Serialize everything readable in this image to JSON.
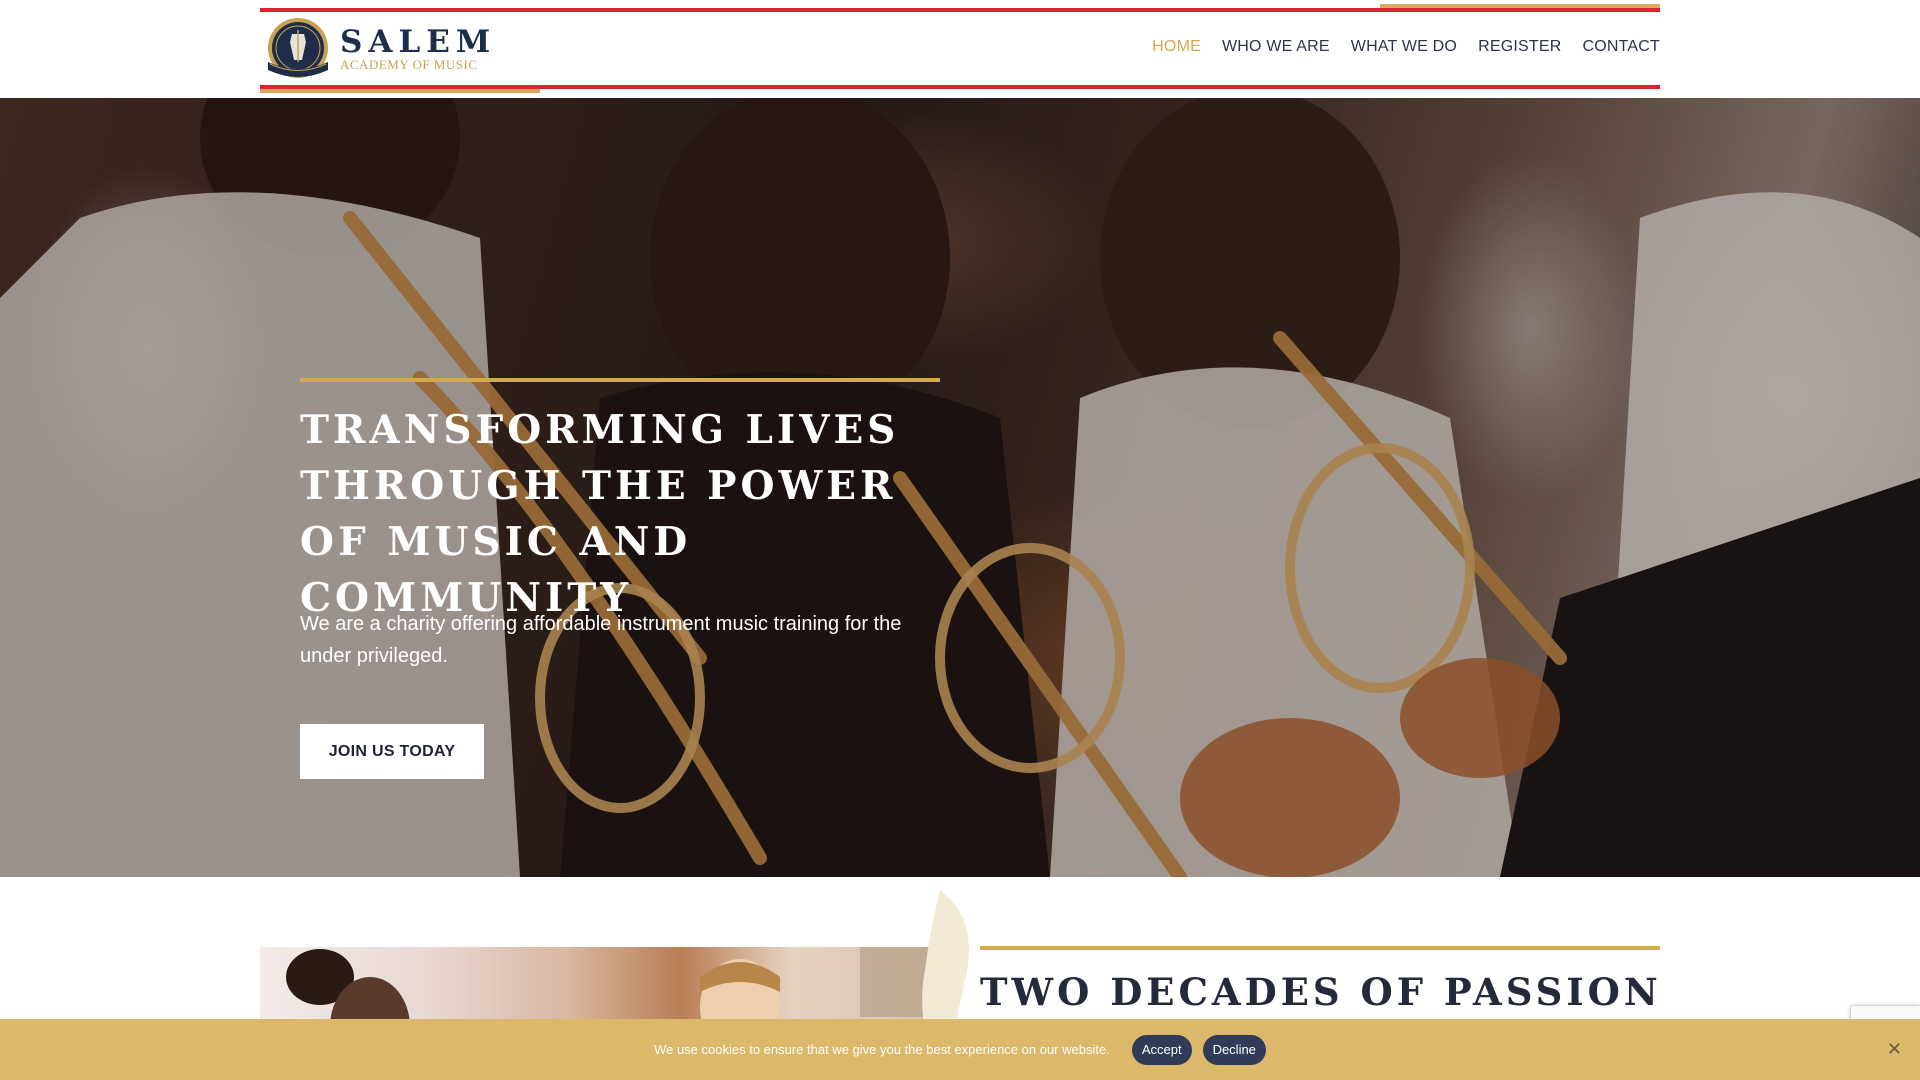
{
  "header": {
    "logo": {
      "name": "SALEM",
      "subtitle": "ACADEMY OF MUSIC",
      "crest_text": "SALEM ACADEMY OF MUSIC"
    },
    "nav": [
      {
        "label": "HOME",
        "active": true
      },
      {
        "label": "WHO WE ARE",
        "active": false
      },
      {
        "label": "WHAT WE DO",
        "active": false
      },
      {
        "label": "REGISTER",
        "active": false
      },
      {
        "label": "CONTACT",
        "active": false
      }
    ]
  },
  "hero": {
    "title": "TRANSFORMING LIVES THROUGH THE POWER OF MUSIC AND COMMUNITY",
    "text": "We are a charity offering affordable instrument music training for the under privileged.",
    "button_label": "JOIN US TODAY"
  },
  "section2": {
    "title": "TWO DECADES OF PASSION"
  },
  "cookie": {
    "text": "We use cookies to ensure that we give you the best experience on our website.",
    "accept_label": "Accept",
    "decline_label": "Decline",
    "close_icon": "close-icon"
  },
  "colors": {
    "accent_gold": "#d4aa4f",
    "accent_red": "#d7262d",
    "navy": "#1f2c4a",
    "cookie_bar": "#dcb86a",
    "cookie_button": "#2f3b57"
  }
}
